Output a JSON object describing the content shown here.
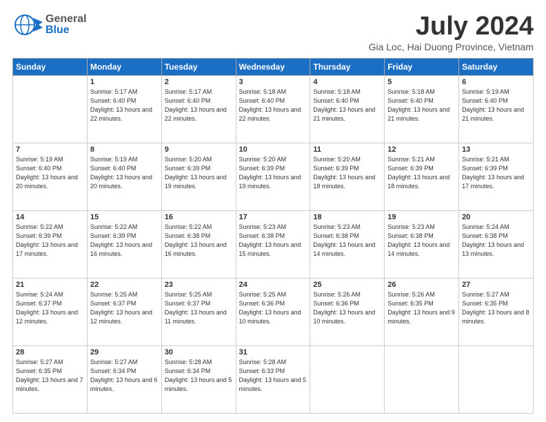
{
  "header": {
    "logo_general": "General",
    "logo_blue": "Blue",
    "month_title": "July 2024",
    "location": "Gia Loc, Hai Duong Province, Vietnam"
  },
  "weekdays": [
    "Sunday",
    "Monday",
    "Tuesday",
    "Wednesday",
    "Thursday",
    "Friday",
    "Saturday"
  ],
  "weeks": [
    [
      {
        "day": "",
        "info": ""
      },
      {
        "day": "1",
        "info": "Sunrise: 5:17 AM\nSunset: 6:40 PM\nDaylight: 13 hours\nand 22 minutes."
      },
      {
        "day": "2",
        "info": "Sunrise: 5:17 AM\nSunset: 6:40 PM\nDaylight: 13 hours\nand 22 minutes."
      },
      {
        "day": "3",
        "info": "Sunrise: 5:18 AM\nSunset: 6:40 PM\nDaylight: 13 hours\nand 22 minutes."
      },
      {
        "day": "4",
        "info": "Sunrise: 5:18 AM\nSunset: 6:40 PM\nDaylight: 13 hours\nand 21 minutes."
      },
      {
        "day": "5",
        "info": "Sunrise: 5:18 AM\nSunset: 6:40 PM\nDaylight: 13 hours\nand 21 minutes."
      },
      {
        "day": "6",
        "info": "Sunrise: 5:19 AM\nSunset: 6:40 PM\nDaylight: 13 hours\nand 21 minutes."
      }
    ],
    [
      {
        "day": "7",
        "info": "Sunrise: 5:19 AM\nSunset: 6:40 PM\nDaylight: 13 hours\nand 20 minutes."
      },
      {
        "day": "8",
        "info": "Sunrise: 5:19 AM\nSunset: 6:40 PM\nDaylight: 13 hours\nand 20 minutes."
      },
      {
        "day": "9",
        "info": "Sunrise: 5:20 AM\nSunset: 6:39 PM\nDaylight: 13 hours\nand 19 minutes."
      },
      {
        "day": "10",
        "info": "Sunrise: 5:20 AM\nSunset: 6:39 PM\nDaylight: 13 hours\nand 19 minutes."
      },
      {
        "day": "11",
        "info": "Sunrise: 5:20 AM\nSunset: 6:39 PM\nDaylight: 13 hours\nand 18 minutes."
      },
      {
        "day": "12",
        "info": "Sunrise: 5:21 AM\nSunset: 6:39 PM\nDaylight: 13 hours\nand 18 minutes."
      },
      {
        "day": "13",
        "info": "Sunrise: 5:21 AM\nSunset: 6:39 PM\nDaylight: 13 hours\nand 17 minutes."
      }
    ],
    [
      {
        "day": "14",
        "info": "Sunrise: 5:22 AM\nSunset: 6:39 PM\nDaylight: 13 hours\nand 17 minutes."
      },
      {
        "day": "15",
        "info": "Sunrise: 5:22 AM\nSunset: 6:39 PM\nDaylight: 13 hours\nand 16 minutes."
      },
      {
        "day": "16",
        "info": "Sunrise: 5:22 AM\nSunset: 6:38 PM\nDaylight: 13 hours\nand 16 minutes."
      },
      {
        "day": "17",
        "info": "Sunrise: 5:23 AM\nSunset: 6:38 PM\nDaylight: 13 hours\nand 15 minutes."
      },
      {
        "day": "18",
        "info": "Sunrise: 5:23 AM\nSunset: 6:38 PM\nDaylight: 13 hours\nand 14 minutes."
      },
      {
        "day": "19",
        "info": "Sunrise: 5:23 AM\nSunset: 6:38 PM\nDaylight: 13 hours\nand 14 minutes."
      },
      {
        "day": "20",
        "info": "Sunrise: 5:24 AM\nSunset: 6:38 PM\nDaylight: 13 hours\nand 13 minutes."
      }
    ],
    [
      {
        "day": "21",
        "info": "Sunrise: 5:24 AM\nSunset: 6:37 PM\nDaylight: 13 hours\nand 12 minutes."
      },
      {
        "day": "22",
        "info": "Sunrise: 5:25 AM\nSunset: 6:37 PM\nDaylight: 13 hours\nand 12 minutes."
      },
      {
        "day": "23",
        "info": "Sunrise: 5:25 AM\nSunset: 6:37 PM\nDaylight: 13 hours\nand 11 minutes."
      },
      {
        "day": "24",
        "info": "Sunrise: 5:25 AM\nSunset: 6:36 PM\nDaylight: 13 hours\nand 10 minutes."
      },
      {
        "day": "25",
        "info": "Sunrise: 5:26 AM\nSunset: 6:36 PM\nDaylight: 13 hours\nand 10 minutes."
      },
      {
        "day": "26",
        "info": "Sunrise: 5:26 AM\nSunset: 6:35 PM\nDaylight: 13 hours\nand 9 minutes."
      },
      {
        "day": "27",
        "info": "Sunrise: 5:27 AM\nSunset: 6:35 PM\nDaylight: 13 hours\nand 8 minutes."
      }
    ],
    [
      {
        "day": "28",
        "info": "Sunrise: 5:27 AM\nSunset: 6:35 PM\nDaylight: 13 hours\nand 7 minutes."
      },
      {
        "day": "29",
        "info": "Sunrise: 5:27 AM\nSunset: 6:34 PM\nDaylight: 13 hours\nand 6 minutes."
      },
      {
        "day": "30",
        "info": "Sunrise: 5:28 AM\nSunset: 6:34 PM\nDaylight: 13 hours\nand 5 minutes."
      },
      {
        "day": "31",
        "info": "Sunrise: 5:28 AM\nSunset: 6:33 PM\nDaylight: 13 hours\nand 5 minutes."
      },
      {
        "day": "",
        "info": ""
      },
      {
        "day": "",
        "info": ""
      },
      {
        "day": "",
        "info": ""
      }
    ]
  ]
}
